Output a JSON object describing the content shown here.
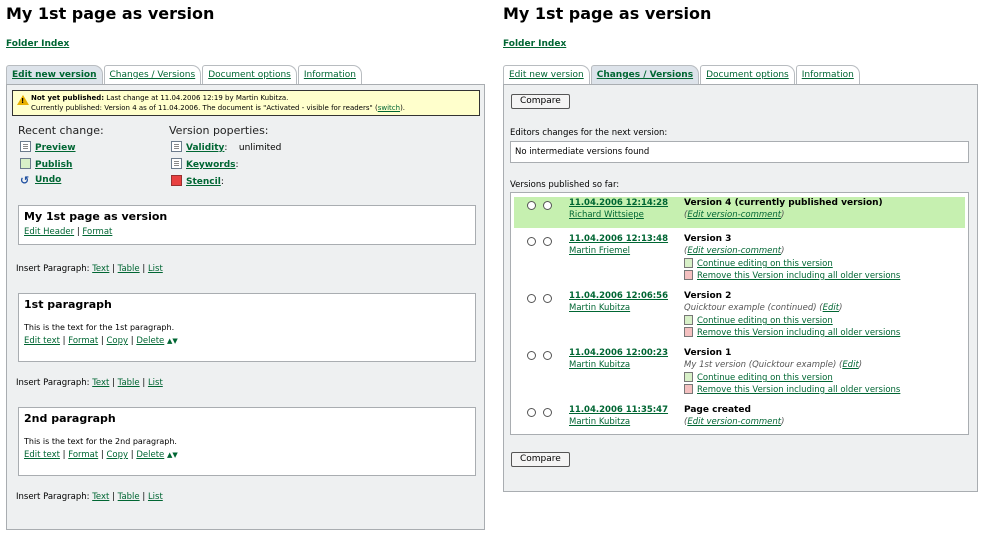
{
  "left": {
    "title": "My 1st page as version",
    "folder_index": "Folder Index",
    "tabs": [
      "Edit new version",
      "Changes / Versions",
      "Document options",
      "Information"
    ],
    "warning": {
      "bold": "Not yet published:",
      "line1": " Last change at 11.04.2006 12:19 by Martin Kubitza.",
      "line2": "Currently published: Version 4 as of 11.04.2006.    The document is \"Activated - visible for readers\" (",
      "switch": "switch",
      "line2_end": ")."
    },
    "recent_change": {
      "heading": "Recent change:",
      "items": [
        "Preview",
        "Publish",
        "Undo"
      ]
    },
    "version_properties": {
      "heading": "Version poperties:",
      "validity": "Validity",
      "validity_value": "unlimited",
      "keywords": "Keywords",
      "stencil": "Stencil"
    },
    "header_box": {
      "title": "My 1st page as version",
      "edit_header": "Edit Header",
      "format": "Format"
    },
    "insert": {
      "label": "Insert Paragraph:",
      "text": "Text",
      "table": "Table",
      "list": "List"
    },
    "paragraphs": [
      {
        "title": "1st paragraph",
        "text": "This is the text for the 1st paragraph."
      },
      {
        "title": "2nd paragraph",
        "text": "This is the text for the 2nd paragraph."
      }
    ],
    "para_links": {
      "edit_text": "Edit text",
      "format": "Format",
      "copy": "Copy",
      "delete": "Delete"
    }
  },
  "right": {
    "title": "My 1st page as version",
    "folder_index": "Folder Index",
    "tabs": [
      "Edit new version",
      "Changes / Versions",
      "Document options",
      "Information"
    ],
    "compare": "Compare",
    "editors_label": "Editors changes for the next version:",
    "editors_value": "No intermediate versions found",
    "published_label": "Versions published so far:",
    "versions": [
      {
        "date": "11.04.2006 12:14:28",
        "user": "Richard Wittsiepe",
        "title": "Version 4 (currently published version)",
        "sub_pre": "(",
        "sub_link": "Edit version-comment",
        "sub_post": ")"
      },
      {
        "date": "11.04.2006 12:13:48",
        "user": "Martin Friemel",
        "title": "Version 3",
        "sub_pre": "(",
        "sub_link": "Edit version-comment",
        "sub_post": ")"
      },
      {
        "date": "11.04.2006 12:06:56",
        "user": "Martin Kubitza",
        "title": "Version 2",
        "sub_pre": "Quicktour example (continued) (",
        "sub_link": "Edit",
        "sub_post": ")"
      },
      {
        "date": "11.04.2006 12:00:23",
        "user": "Martin Kubitza",
        "title": "Version 1",
        "sub_pre": "My 1st version (Quicktour example) (",
        "sub_link": "Edit",
        "sub_post": ")"
      },
      {
        "date": "11.04.2006 11:35:47",
        "user": "Martin Kubitza",
        "title": "Page created",
        "sub_pre": "(",
        "sub_link": "Edit version-comment",
        "sub_post": ")"
      }
    ],
    "continue_label": "Continue editing on this version",
    "remove_label": "Remove this Version including all older versions"
  }
}
